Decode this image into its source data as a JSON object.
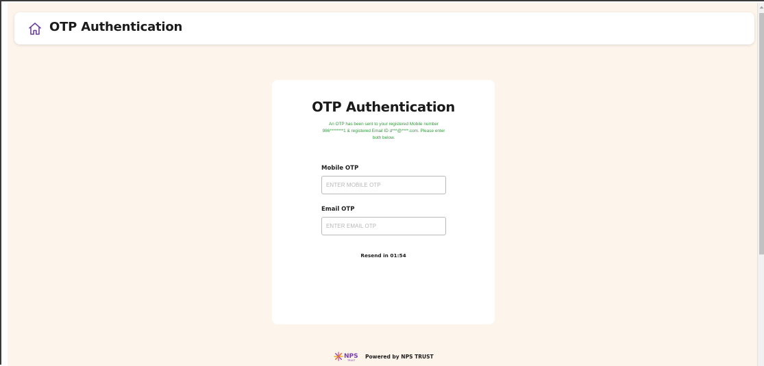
{
  "header": {
    "title": "OTP Authentication",
    "icon": "home-icon"
  },
  "card": {
    "title": "OTP Authentication",
    "message": "An OTP has been sent to your registered Mobile number 986********1 & registered Email ID d***@****.com. Please enter both below.",
    "mobile_label": "Mobile OTP",
    "mobile_placeholder": "ENTER MOBILE OTP",
    "mobile_value": "",
    "email_label": "Email OTP",
    "email_placeholder": "ENTER EMAIL OTP",
    "email_value": "",
    "resend_text": "Resend in 01:54"
  },
  "footer": {
    "logo_text": "NPS",
    "logo_subtext": "TRUST",
    "text": "Powered by NPS TRUST"
  },
  "colors": {
    "background": "#fdf4eb",
    "message_green": "#2f9a3a",
    "home_icon_purple": "#6b3fa0"
  }
}
